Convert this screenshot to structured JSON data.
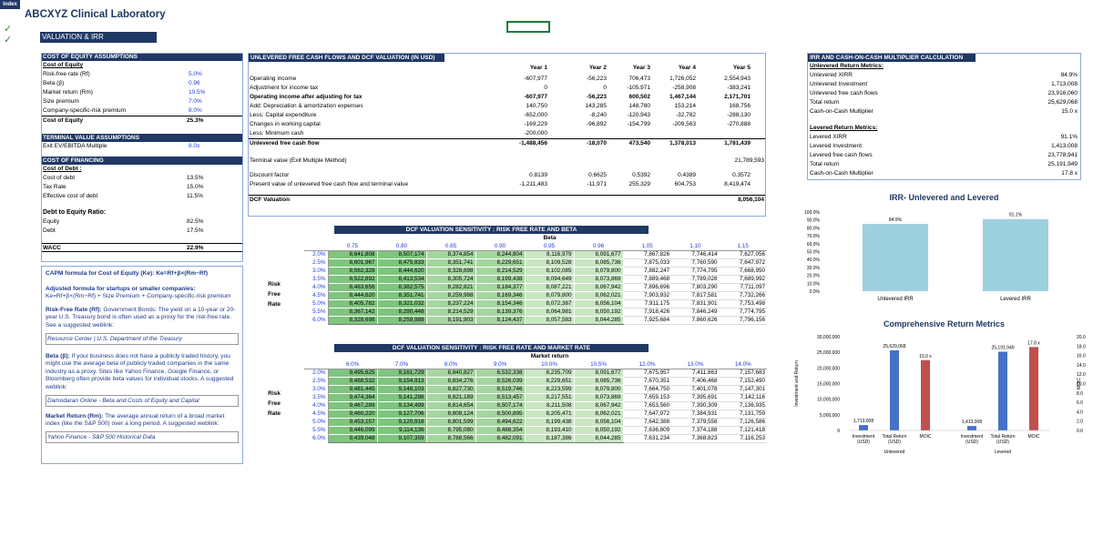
{
  "tab_label": "Index",
  "title": "ABCXYZ Clinical Laboratory",
  "section_title": "VALUATION & IRR",
  "checkmarks": [
    "✓",
    "✓"
  ],
  "coe": {
    "header": "COST OF EQUITY ASSUMPTIONS",
    "sub": "Cost of Equity",
    "rows": [
      [
        "Risk-free rate (Rf)",
        "5.0%"
      ],
      [
        "Beta (β)",
        "0.96"
      ],
      [
        "Market return (Rm)",
        "10.5%"
      ],
      [
        "Size premium",
        "7.0%"
      ],
      [
        "Company-specific-risk premium",
        "8.0%"
      ]
    ],
    "total": [
      "Cost of Equity",
      "25.3%"
    ]
  },
  "tv": {
    "header": "TERMINAL VALUE ASSUMPTIONS",
    "row": [
      "Exit EV/EBITDA Multiple",
      "8.0x"
    ]
  },
  "cof": {
    "header": "COST OF FINANCING",
    "sub": "Cost of Debt :",
    "rows": [
      [
        "Cost of debt",
        "13.5%"
      ],
      [
        "Tax Rate",
        "15.0%"
      ],
      [
        "Effective cost of debt",
        "11.5%"
      ]
    ]
  },
  "de": {
    "title": "Debt to Equity Ratio:",
    "rows": [
      [
        "Equity",
        "82.5%"
      ],
      [
        "Debt",
        "17.5%"
      ]
    ]
  },
  "wacc": [
    "WACC",
    "22.9%"
  ],
  "notes": {
    "capm": "CAPM formula for Cost of Equity (Ke): Ke=Rf+β×(Rm−Rf)",
    "adj_title": "Adjusted formula for startups or smaller companies:",
    "adj_body": "Ke=Rf+β×(Rm−Rf) + Size Premium + Company-specific-risk premium",
    "rf_bold": "Risk-Free Rate (Rf):",
    "rf_body": " Government Bonds: The yield on a 10-year or 20-year U.S. Treasury bond is often used as a proxy for the risk-free rate. See a suggested weblink:",
    "rf_link": "Resource Center | U.S. Department of the Treasury",
    "beta_bold": "Beta (β):",
    "beta_body": " If your business does not have a publicly traded history, you might use the average beta of publicly traded companies in the same industry as a proxy. Sites like Yahoo Finance, Google Finance, or Bloomberg often provide beta values for individual stocks. A suggested weblink:",
    "beta_link": "Damodaran Online - Beta and Costs of Equity and Capital",
    "mr_bold": "Market Return (Rm):",
    "mr_body": " The average annual return of a broad market index (like the S&P 500) over a long period. A suggested weblink:",
    "mr_link": "Yahoo Finance - S&P 500 Historical Data"
  },
  "dcf": {
    "header": "UNLEVERED FREE CASH FLOWS AND DCF VALUATION (IN USD)",
    "years": [
      "Year 1",
      "Year 2",
      "Year 3",
      "Year 4",
      "Year 5"
    ],
    "rows": [
      {
        "label": "Operating income",
        "vals": [
          "-607,977",
          "-56,223",
          "706,473",
          "1,726,052",
          "2,554,943"
        ]
      },
      {
        "label": "Adjustment for income tax",
        "vals": [
          "0",
          "0",
          "-105,971",
          "-258,908",
          "-383,241"
        ]
      },
      {
        "label": "Operating income after adjusting for tax",
        "vals": [
          "-607,977",
          "-56,223",
          "600,502",
          "1,467,144",
          "2,171,701"
        ],
        "bold": true
      },
      {
        "label": "Add: Depreciation & amortization expenses",
        "vals": [
          "140,750",
          "143,285",
          "148,780",
          "153,214",
          "168,756"
        ]
      },
      {
        "label": "Less: Capital expenditure",
        "vals": [
          "-652,000",
          "-8,240",
          "-120,943",
          "-32,782",
          "-288,130"
        ]
      },
      {
        "label": "Changes in working capital",
        "vals": [
          "-169,229",
          "-96,892",
          "-154,799",
          "-209,563",
          "-270,888"
        ]
      },
      {
        "label": "Less: Minimum cash",
        "vals": [
          "-200,000",
          "",
          "",
          "",
          ""
        ]
      },
      {
        "label": "Unlevered free cash flow",
        "vals": [
          "-1,488,456",
          "-18,070",
          "473,540",
          "1,378,013",
          "1,781,439"
        ],
        "bold": true
      }
    ],
    "tv_label": "Terminal value (Exit Multiple Method)",
    "tv_val": "21,789,593",
    "df_label": "Discount factor",
    "df_vals": [
      "0.8139",
      "0.6625",
      "0.5392",
      "0.4389",
      "0.3572"
    ],
    "pv_label": "Present value of unlevered free cash flow and terminal value",
    "pv_vals": [
      "-1,211,483",
      "-11,971",
      "255,329",
      "604,753",
      "8,419,474"
    ],
    "val_label": "DCF Valuation",
    "val": "8,056,104"
  },
  "sens1": {
    "header": "DCF VALUATION SENSITIVITY : RISK FREE RATE AND BETA",
    "axis": "Beta",
    "side": [
      "Risk",
      "Free",
      "Rate"
    ],
    "cols": [
      "0.75",
      "0.80",
      "0.85",
      "0.90",
      "0.95",
      "0.96",
      "1.05",
      "1.10",
      "1.15"
    ],
    "rows": [
      [
        "2.0%",
        "8,641,808",
        "8,507,174",
        "8,374,854",
        "8,244,804",
        "8,116,979",
        "8,091,677",
        "7,867,826",
        "7,746,414",
        "7,627,056"
      ],
      [
        "2.5%",
        "8,601,967",
        "8,475,833",
        "8,351,741",
        "8,229,651",
        "8,109,528",
        "8,085,736",
        "7,875,033",
        "7,760,590",
        "7,647,972"
      ],
      [
        "3.0%",
        "8,562,328",
        "8,444,620",
        "8,328,698",
        "8,214,529",
        "8,102,085",
        "8,079,800",
        "7,882,247",
        "7,774,795",
        "7,668,950"
      ],
      [
        "3.5%",
        "8,522,892",
        "8,413,534",
        "8,305,724",
        "8,199,438",
        "8,094,649",
        "8,073,869",
        "7,889,468",
        "7,789,028",
        "7,689,992"
      ],
      [
        "4.0%",
        "8,483,656",
        "8,382,575",
        "8,282,821",
        "8,184,377",
        "8,087,221",
        "8,067,942",
        "7,896,696",
        "7,803,290",
        "7,711,097"
      ],
      [
        "4.5%",
        "8,444,620",
        "8,351,741",
        "8,259,988",
        "8,169,346",
        "8,079,800",
        "8,062,021",
        "7,903,932",
        "7,817,581",
        "7,732,266"
      ],
      [
        "5.0%",
        "8,405,782",
        "8,321,032",
        "8,237,224",
        "8,154,346",
        "8,072,387",
        "8,056,104",
        "7,911,175",
        "7,831,901",
        "7,753,498"
      ],
      [
        "5.5%",
        "8,367,142",
        "8,290,448",
        "8,214,529",
        "8,139,376",
        "8,064,981",
        "8,050,192",
        "7,918,426",
        "7,846,249",
        "7,774,795"
      ],
      [
        "6.0%",
        "8,328,698",
        "8,259,988",
        "8,191,903",
        "8,124,437",
        "8,057,583",
        "8,044,285",
        "7,925,684",
        "7,860,626",
        "7,796,156"
      ]
    ]
  },
  "sens2": {
    "header": "DCF VALUATION SENSITIVITY : RISK FREE RATE AND MARKET RATE",
    "axis": "Market return",
    "side": [
      "Risk",
      "Free",
      "Rate"
    ],
    "cols": [
      "6.0%",
      "7.0%",
      "8.0%",
      "9.0%",
      "10.0%",
      "10.5%",
      "12.0%",
      "13.0%",
      "14.0%"
    ],
    "rows": [
      [
        "2.0%",
        "9,495,625",
        "9,161,729",
        "8,840,827",
        "8,532,338",
        "8,235,709",
        "8,091,677",
        "7,675,957",
        "7,411,863",
        "7,157,683"
      ],
      [
        "2.5%",
        "9,488,532",
        "9,154,913",
        "8,834,276",
        "8,526,039",
        "8,229,651",
        "8,085,736",
        "7,670,351",
        "7,406,468",
        "7,152,490"
      ],
      [
        "3.0%",
        "9,481,445",
        "9,148,103",
        "8,827,730",
        "8,519,746",
        "8,223,599",
        "8,079,800",
        "7,664,750",
        "7,401,078",
        "7,147,301"
      ],
      [
        "3.5%",
        "9,474,364",
        "9,141,298",
        "8,821,189",
        "8,513,457",
        "8,217,551",
        "8,073,869",
        "7,659,153",
        "7,395,691",
        "7,142,116"
      ],
      [
        "4.0%",
        "9,467,289",
        "9,134,499",
        "8,814,654",
        "8,507,174",
        "8,211,508",
        "8,067,942",
        "7,653,560",
        "7,390,309",
        "7,136,935"
      ],
      [
        "4.5%",
        "9,460,220",
        "9,127,706",
        "8,808,124",
        "8,500,895",
        "8,205,471",
        "8,062,021",
        "7,647,972",
        "7,384,931",
        "7,131,759"
      ],
      [
        "5.0%",
        "9,453,157",
        "9,120,918",
        "8,801,599",
        "8,494,622",
        "8,199,438",
        "8,056,104",
        "7,642,388",
        "7,379,558",
        "7,126,586"
      ],
      [
        "5.5%",
        "9,446,099",
        "9,114,136",
        "8,795,080",
        "8,488,354",
        "8,193,410",
        "8,050,192",
        "7,636,809",
        "7,374,188",
        "7,121,418"
      ],
      [
        "6.0%",
        "9,439,048",
        "9,107,359",
        "8,788,566",
        "8,482,091",
        "8,187,386",
        "8,044,285",
        "7,631,234",
        "7,368,823",
        "7,116,253"
      ]
    ]
  },
  "irr": {
    "header": "IRR AND CASH-ON-CASH MULTIPLIER CALCULATION",
    "unlev_title": "Unlevered Return Metrics:",
    "unlev": [
      [
        "Unlevered XIRR",
        "84.9%"
      ],
      [
        "Unlevered Investment",
        "1,713,008"
      ],
      [
        "Unlevered free cash flows",
        "23,916,060"
      ],
      [
        "Total return",
        "25,629,068"
      ],
      [
        "Cash-on-Cash Multiplier",
        "15.0 x"
      ]
    ],
    "lev_title": "Levered Return Metrics:",
    "lev": [
      [
        "Levered XIRR",
        "91.1%"
      ],
      [
        "Levered Investment",
        "1,413,008"
      ],
      [
        "Levered free cash flows",
        "23,778,941"
      ],
      [
        "Total return",
        "25,191,949"
      ],
      [
        "Cash-on-Cash Multiplier",
        "17.8 x"
      ]
    ]
  },
  "chart_data": [
    {
      "type": "bar",
      "title": "IRR- Unlevered and Levered",
      "categories": [
        "Unlevered IRR",
        "Levered IRR"
      ],
      "values": [
        84.9,
        91.1
      ],
      "value_labels": [
        "84.9%",
        "91.1%"
      ],
      "ylim": [
        0,
        100
      ],
      "yticks": [
        "100.0%",
        "90.0%",
        "80.0%",
        "70.0%",
        "60.0%",
        "50.0%",
        "40.0%",
        "30.0%",
        "20.0%",
        "10.0%",
        "0.0%"
      ],
      "color": "#9dd0df"
    },
    {
      "type": "bar",
      "title": "Comprehensive Return Metrics",
      "ylabel": "Investment and Return",
      "y2label": "MOIC",
      "categories": [
        "Investment (USD)",
        "Total Return (USD)",
        "MOIC",
        "Investment (USD)",
        "Total Return (USD)",
        "MOIC"
      ],
      "groups": [
        "Unlevered",
        "Levered"
      ],
      "values": [
        1713008,
        25629068,
        15.0,
        1413008,
        25191949,
        17.8
      ],
      "value_labels": [
        "1,713,008",
        "25,629,068",
        "15.0 x",
        "1,413,008",
        "25,191,949",
        "17.8 x"
      ],
      "ylim": [
        0,
        30000000
      ],
      "y2lim": [
        0,
        20
      ],
      "yticks": [
        "30,000,000",
        "25,000,000",
        "20,000,000",
        "15,000,000",
        "10,000,000",
        "5,000,000",
        "0"
      ],
      "y2ticks": [
        "20.0",
        "18.0",
        "16.0",
        "14.0",
        "12.0",
        "10.0",
        "8.0",
        "6.0",
        "4.0",
        "2.0",
        "0.0"
      ],
      "colors": {
        "usd": "#4472c4",
        "moic": "#c0504d"
      }
    }
  ]
}
